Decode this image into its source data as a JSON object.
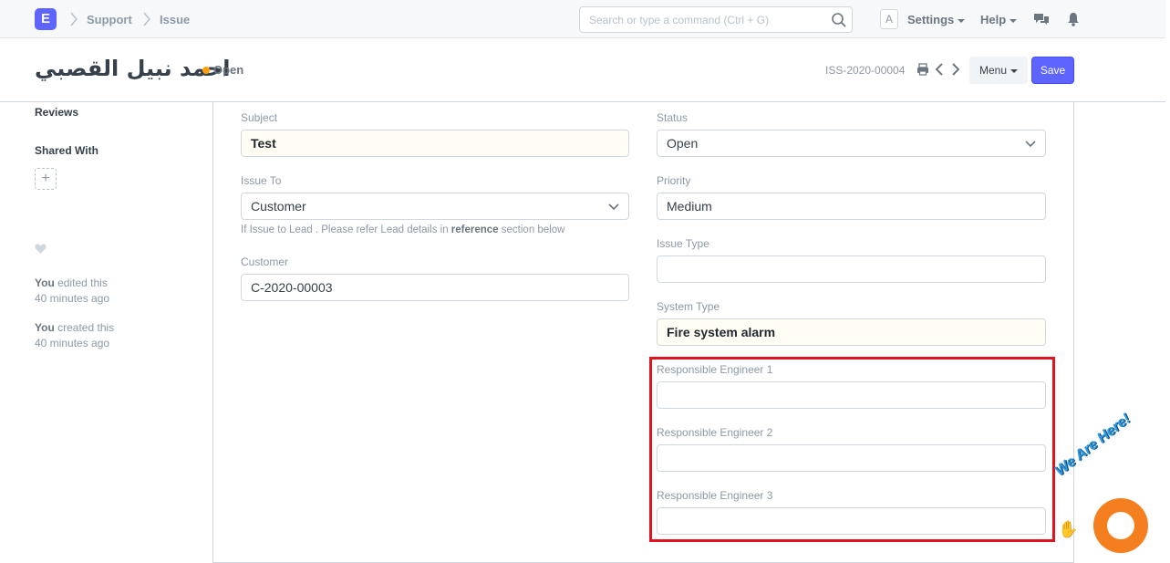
{
  "navbar": {
    "logo_letter": "E",
    "breadcrumbs": [
      "Support",
      "Issue"
    ],
    "search_placeholder": "Search or type a command (Ctrl + G)",
    "avatar_letter": "A",
    "settings_label": "Settings",
    "help_label": "Help"
  },
  "page_head": {
    "title": "احمد نبيل القصبي",
    "status": "Open",
    "doc_name": "ISS-2020-00004",
    "menu_label": "Menu",
    "save_label": "Save"
  },
  "sidebar": {
    "reviews_label": "Reviews",
    "shared_with_label": "Shared With",
    "activity": [
      {
        "who": "You",
        "action": "edited this",
        "when": "40 minutes ago"
      },
      {
        "who": "You",
        "action": "created this",
        "when": "40 minutes ago"
      }
    ]
  },
  "form": {
    "subject": {
      "label": "Subject",
      "value": "Test"
    },
    "issue_to": {
      "label": "Issue To",
      "value": "Customer"
    },
    "issue_to_help": {
      "pre": "If Issue to Lead . Please refer Lead details in ",
      "bold": "reference",
      "post": " section below"
    },
    "customer": {
      "label": "Customer",
      "value": "C-2020-00003"
    },
    "status": {
      "label": "Status",
      "value": "Open"
    },
    "priority": {
      "label": "Priority",
      "value": "Medium"
    },
    "issue_type": {
      "label": "Issue Type",
      "value": ""
    },
    "system_type": {
      "label": "System Type",
      "value": "Fire system alarm"
    },
    "engineer1": {
      "label": "Responsible Engineer 1",
      "value": ""
    },
    "engineer2": {
      "label": "Responsible Engineer 2",
      "value": ""
    },
    "engineer3": {
      "label": "Responsible Engineer 3",
      "value": ""
    }
  },
  "chat_widget": {
    "tagline": "We Are Here!"
  },
  "colors": {
    "primary": "#5e64ff",
    "status_open": "#ffa00a",
    "highlight": "#e0141e",
    "chat": "#f57f1e"
  }
}
